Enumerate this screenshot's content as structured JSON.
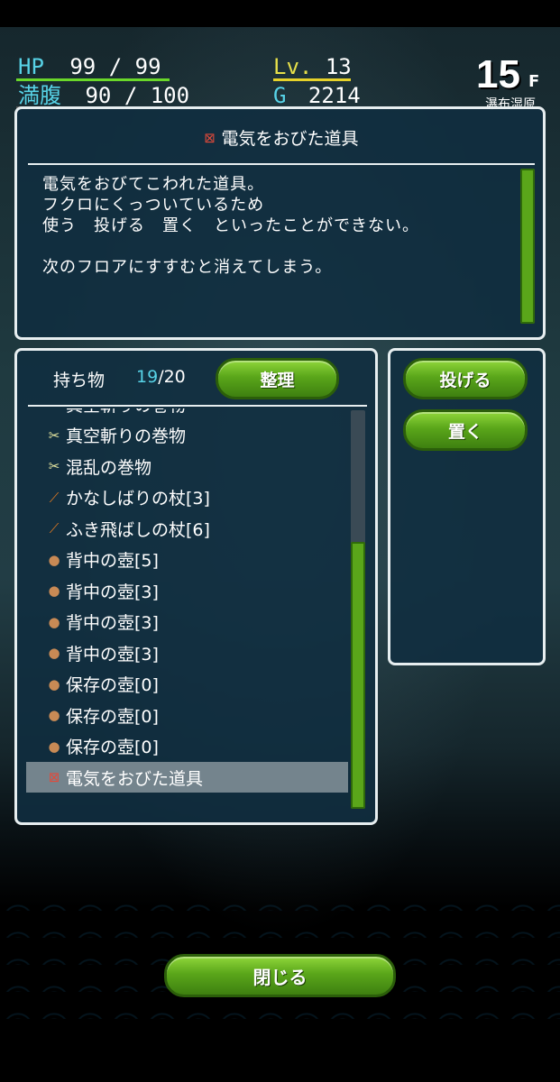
{
  "status": {
    "hp_label": "HP",
    "hp_current": "99",
    "hp_sep": "/",
    "hp_max": "99",
    "hunger_label": "満腹",
    "hunger_current": "90",
    "hunger_sep": "/",
    "hunger_max": "100",
    "level_label": "Lv.",
    "level_value": "13",
    "gold_label": "G",
    "gold_value": "2214",
    "hp_fraction": 1.0,
    "hunger_fraction": 0.9,
    "floor_number": "15",
    "floor_unit": "F",
    "floor_name": "瀑布湿原"
  },
  "description": {
    "title": "電気をおびた道具",
    "text": "電気をおびてこわれた道具。\nフクロにくっついているため\n使う　投げる　置く　といったことができない。\n\n次のフロアにすすむと消えてしまう。"
  },
  "inventory": {
    "header": "持ち物",
    "count_current": "19",
    "count_sep": "/",
    "count_max": "20",
    "sort_label": "整理",
    "items": [
      {
        "icon": "scroll-icon",
        "name": "真空斬りの巻物"
      },
      {
        "icon": "scroll-icon",
        "name": "真空斬りの巻物"
      },
      {
        "icon": "scroll-icon",
        "name": "混乱の巻物"
      },
      {
        "icon": "staff-icon",
        "name": "かなしばりの杖[3]"
      },
      {
        "icon": "staff-icon",
        "name": "ふき飛ばしの杖[6]"
      },
      {
        "icon": "pot-icon",
        "name": "背中の壺[5]"
      },
      {
        "icon": "pot-icon",
        "name": "背中の壺[3]"
      },
      {
        "icon": "pot-icon",
        "name": "背中の壺[3]"
      },
      {
        "icon": "pot-icon",
        "name": "背中の壺[3]"
      },
      {
        "icon": "pot-icon",
        "name": "保存の壺[0]"
      },
      {
        "icon": "pot-icon",
        "name": "保存の壺[0]"
      },
      {
        "icon": "pot-icon",
        "name": "保存の壺[0]"
      },
      {
        "icon": "broken-item-icon",
        "name": "電気をおびた道具",
        "selected": true
      }
    ]
  },
  "actions": {
    "throw_label": "投げる",
    "place_label": "置く"
  },
  "close_label": "閉じる"
}
